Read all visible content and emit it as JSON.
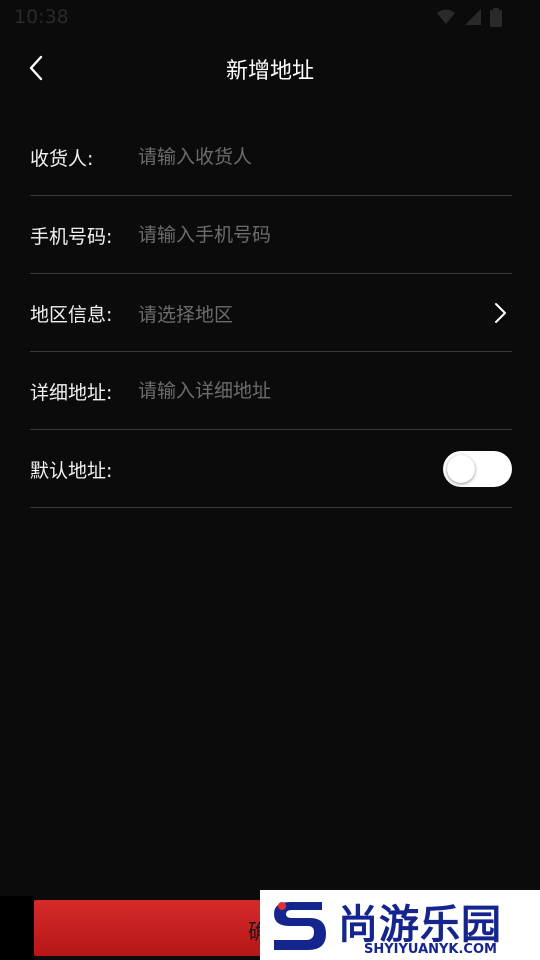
{
  "status_bar": {
    "time": "10:38"
  },
  "header": {
    "title": "新增地址"
  },
  "form": {
    "receiver": {
      "label": "收货人:",
      "placeholder": "请输入收货人"
    },
    "phone": {
      "label": "手机号码:",
      "placeholder": "请输入手机号码"
    },
    "region": {
      "label": "地区信息:",
      "placeholder": "请选择地区"
    },
    "detail": {
      "label": "详细地址:",
      "placeholder": "请输入详细地址"
    },
    "default": {
      "label": "默认地址:",
      "enabled": false
    }
  },
  "confirm": {
    "label": "确认"
  },
  "watermark": {
    "name": "尚游乐园",
    "url": "SHYIYUANYK.COM"
  },
  "colors": {
    "background": "#0b0b0b",
    "accent": "#c91f1f",
    "placeholder": "#6c6c6c",
    "divider": "#3a3a3a"
  },
  "icons": [
    "wifi-icon",
    "signal-icon",
    "battery-icon",
    "back-arrow-icon",
    "chevron-right-icon"
  ]
}
